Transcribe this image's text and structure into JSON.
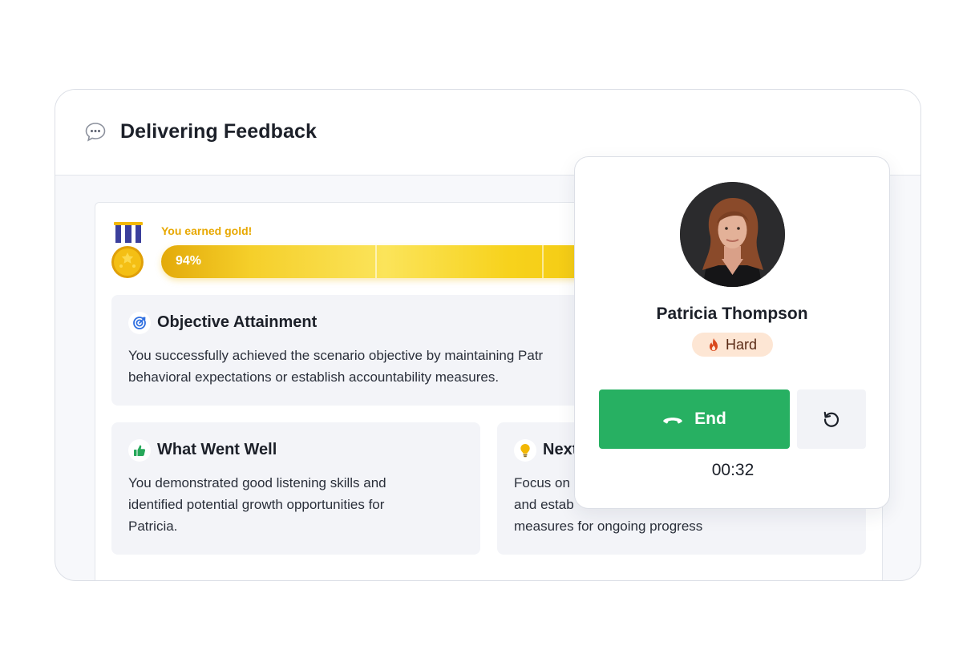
{
  "header": {
    "title": "Delivering Feedback",
    "icon": "speech-bubble-icon"
  },
  "score": {
    "earned_label": "You earned gold!",
    "percent_label": "94%",
    "progress": 0.94,
    "medal": "gold-medal-icon",
    "accent": "#e8a800"
  },
  "cards": {
    "objective": {
      "icon": "target-icon",
      "title": "Objective Attainment",
      "lines": [
        "You successfully achieved the scenario objective by maintaining Patr",
        "behavioral expectations or establish accountability measures."
      ]
    },
    "went_well": {
      "icon": "thumbs-up-icon",
      "title": "What Went Well",
      "lines": [
        "You demonstrated good listening skills and",
        "identified potential growth opportunities for",
        "Patricia."
      ]
    },
    "next_steps": {
      "icon": "lightbulb-icon",
      "title": "Next",
      "lines": [
        "Focus on",
        "and estab",
        "measures for ongoing progress"
      ]
    }
  },
  "call": {
    "name": "Patricia Thompson",
    "difficulty": "Hard",
    "difficulty_icon": "flame-icon",
    "end_label": "End",
    "end_icon": "phone-hangup-icon",
    "restart_icon": "restart-icon",
    "timer": "00:32",
    "colors": {
      "end": "#27b062",
      "difficulty_bg": "#fde6d4"
    }
  }
}
